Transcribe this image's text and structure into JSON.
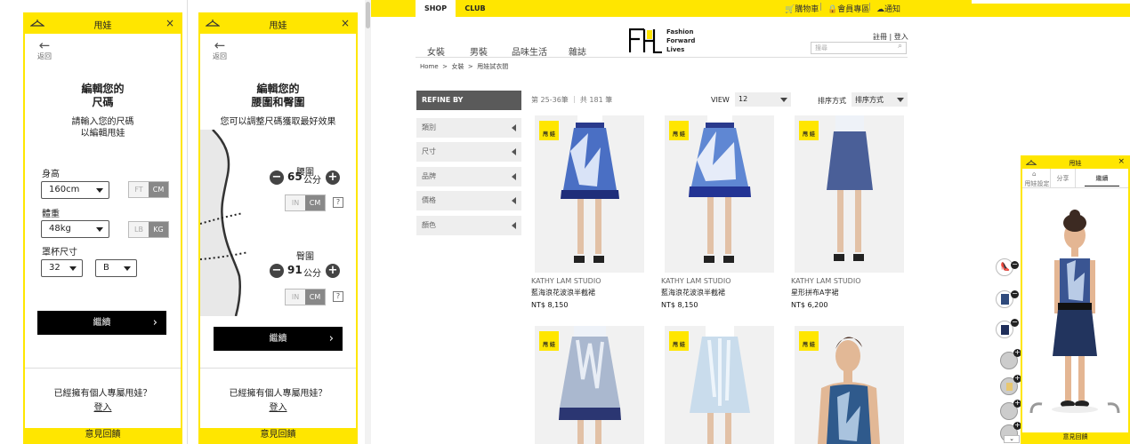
{
  "panel1": {
    "header_title": "甩娃",
    "close": "×",
    "back_label": "返回",
    "title_line1": "編輯您的",
    "title_line2": "尺碼",
    "subtitle_line1": "請輸入您的尺碼",
    "subtitle_line2": "以編輯甩娃",
    "height_label": "身高",
    "height_value": "160cm",
    "height_units": [
      "FT",
      "CM"
    ],
    "weight_label": "體重",
    "weight_value": "48kg",
    "weight_units": [
      "LB",
      "KG"
    ],
    "cup_label": "罩杯尺寸",
    "band_value": "32",
    "cup_value": "B",
    "continue": "繼續",
    "own_doll": "已經擁有個人專屬甩娃？",
    "login": "登入",
    "feedback": "意見回饋"
  },
  "panel2": {
    "header_title": "甩娃",
    "close": "×",
    "back_label": "返回",
    "title_line1": "編輯您的",
    "title_line2": "腰圍和臀圍",
    "subtitle": "您可以調整尺碼獲取最好效果",
    "waist_label": "腰圍",
    "waist_value": "65",
    "hip_label": "臀圍",
    "hip_value": "91",
    "unit": "公分",
    "units": [
      "IN",
      "CM"
    ],
    "help": "?",
    "continue": "繼續",
    "own_doll": "已經擁有個人專屬甩娃？",
    "login": "登入",
    "feedback": "意見回饋"
  },
  "site": {
    "tabs": [
      "SHOP",
      "CLUB"
    ],
    "cart": "購物車",
    "member": "會員專區",
    "notify": "通知",
    "nav": [
      "女裝",
      "男裝",
      "品味生活",
      "雜誌"
    ],
    "logo_text": [
      "Fashion",
      "Forward",
      "Lives"
    ],
    "register_login": "註冊 | 登入",
    "search_placeholder": "搜尋",
    "breadcrumb": [
      "Home",
      ">",
      "女裝",
      ">",
      "甩娃試衣間"
    ],
    "refine_by": "REFINE BY",
    "facets": [
      "類別",
      "尺寸",
      "品牌",
      "價格",
      "顏色"
    ],
    "count": "第 25-36筆 ｜ 共 181 筆",
    "view_label": "VIEW",
    "view_value": "12",
    "sort_label": "排序方式",
    "sort_value": "排序方式",
    "badge": "甩 娃",
    "products": [
      {
        "brand": "KATHY LAM STUDIO",
        "name": "藍海浪花波浪半截裙",
        "price": "NT$ 8,150"
      },
      {
        "brand": "KATHY LAM STUDIO",
        "name": "藍海浪花波浪半截裙",
        "price": "NT$ 8,150"
      },
      {
        "brand": "KATHY LAM STUDIO",
        "name": "星形拼布A字裙",
        "price": "NT$ 6,200"
      }
    ]
  },
  "tryon": {
    "header_title": "甩娃",
    "close": "×",
    "tabs": [
      "甩娃設定",
      "分享",
      "繼續"
    ],
    "feedback": "意見回饋"
  },
  "colors": {
    "accent": "#ffe600",
    "dark": "#000000",
    "refine": "#5a5a5a"
  }
}
